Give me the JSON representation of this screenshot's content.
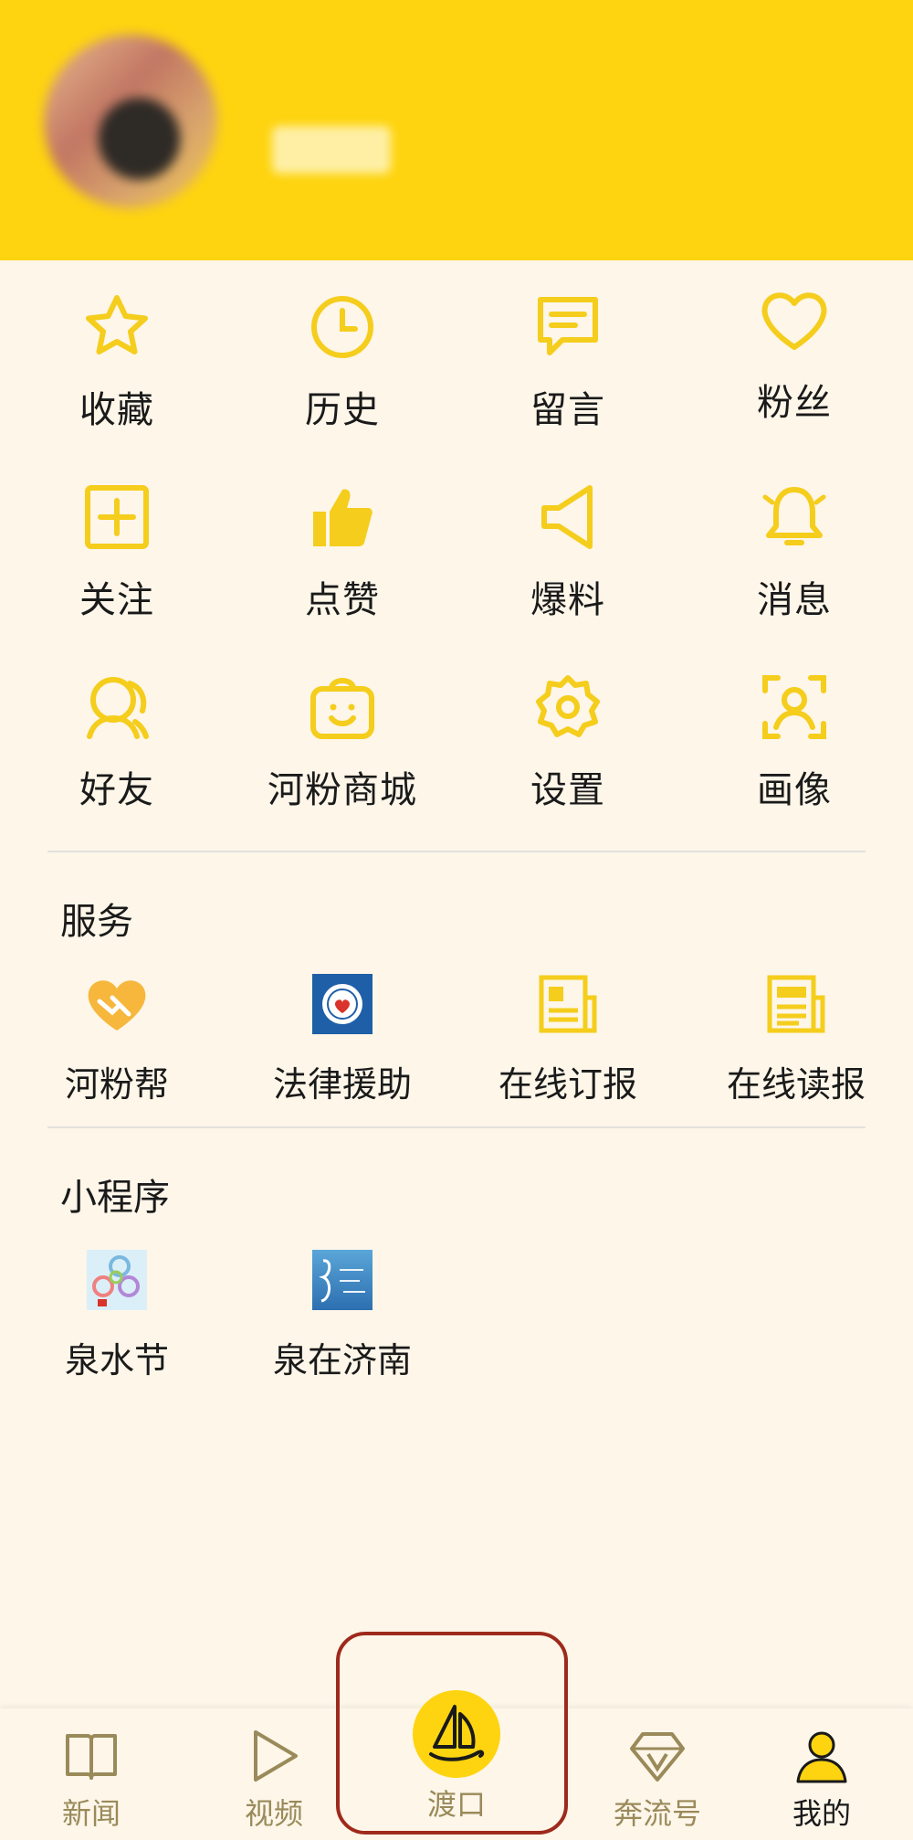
{
  "grid": [
    {
      "label": "收藏",
      "icon": "star-icon"
    },
    {
      "label": "历史",
      "icon": "clock-icon"
    },
    {
      "label": "留言",
      "icon": "message-icon"
    },
    {
      "label": "粉丝",
      "icon": "heart-icon"
    },
    {
      "label": "关注",
      "icon": "plus-square-icon"
    },
    {
      "label": "点赞",
      "icon": "thumbs-up-icon"
    },
    {
      "label": "爆料",
      "icon": "megaphone-icon"
    },
    {
      "label": "消息",
      "icon": "bell-icon"
    },
    {
      "label": "好友",
      "icon": "friends-icon"
    },
    {
      "label": "河粉商城",
      "icon": "shopping-bag-icon"
    },
    {
      "label": "设置",
      "icon": "gear-icon"
    },
    {
      "label": "画像",
      "icon": "portrait-icon"
    }
  ],
  "services": {
    "title": "服务",
    "items": [
      {
        "label": "河粉帮",
        "icon": "handshake-heart-icon"
      },
      {
        "label": "法律援助",
        "icon": "legal-aid-icon"
      },
      {
        "label": "在线订报",
        "icon": "newspaper-subscribe-icon"
      },
      {
        "label": "在线读报",
        "icon": "newspaper-read-icon"
      }
    ]
  },
  "miniprograms": {
    "title": "小程序",
    "items": [
      {
        "label": "泉水节",
        "icon": "spring-festival-icon"
      },
      {
        "label": "泉在济南",
        "icon": "quan-zai-jinan-icon"
      }
    ]
  },
  "nav": [
    {
      "label": "新闻",
      "icon": "book-icon"
    },
    {
      "label": "视频",
      "icon": "play-icon"
    },
    {
      "label": "渡口",
      "icon": "sailboat-icon"
    },
    {
      "label": "奔流号",
      "icon": "diamond-v-icon"
    },
    {
      "label": "我的",
      "icon": "user-icon"
    }
  ],
  "colors": {
    "accent": "#fed410",
    "icon": "#f5cd1c",
    "background": "#fdf6e9",
    "nav_inactive": "#9a8a5a",
    "highlight": "#9e2a1c"
  }
}
